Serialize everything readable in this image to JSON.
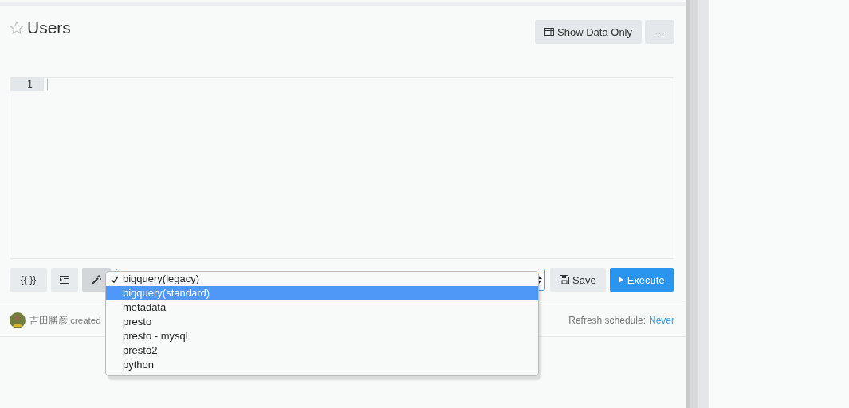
{
  "header": {
    "title": "Users",
    "starred": false,
    "buttons": [
      {
        "kind": "table",
        "label": "Show Data Only"
      },
      {
        "kind": "more",
        "label": "···"
      }
    ]
  },
  "editor": {
    "line_numbers": [
      "1"
    ]
  },
  "toolbar": {
    "buttons": [
      {
        "kind": "text",
        "label": "{{ }}",
        "pressed": false
      },
      {
        "kind": "indent",
        "pressed": false
      },
      {
        "kind": "wand",
        "pressed": true
      }
    ],
    "datasource_menu": {
      "open": true,
      "options": [
        {
          "label": "bigquery(legacy)",
          "checked": true,
          "highlighted": false
        },
        {
          "label": "bigquery(standard)",
          "checked": false,
          "highlighted": true
        },
        {
          "label": "metadata",
          "checked": false,
          "highlighted": false
        },
        {
          "label": "presto",
          "checked": false,
          "highlighted": false
        },
        {
          "label": "presto - mysql",
          "checked": false,
          "highlighted": false
        },
        {
          "label": "presto2",
          "checked": false,
          "highlighted": false
        },
        {
          "label": "python",
          "checked": false,
          "highlighted": false
        }
      ]
    },
    "save": "Save",
    "execute": "Execute"
  },
  "footer": {
    "author": "吉田勝彦 created",
    "refresh_label": "Refresh schedule:",
    "refresh_value": "Never"
  }
}
